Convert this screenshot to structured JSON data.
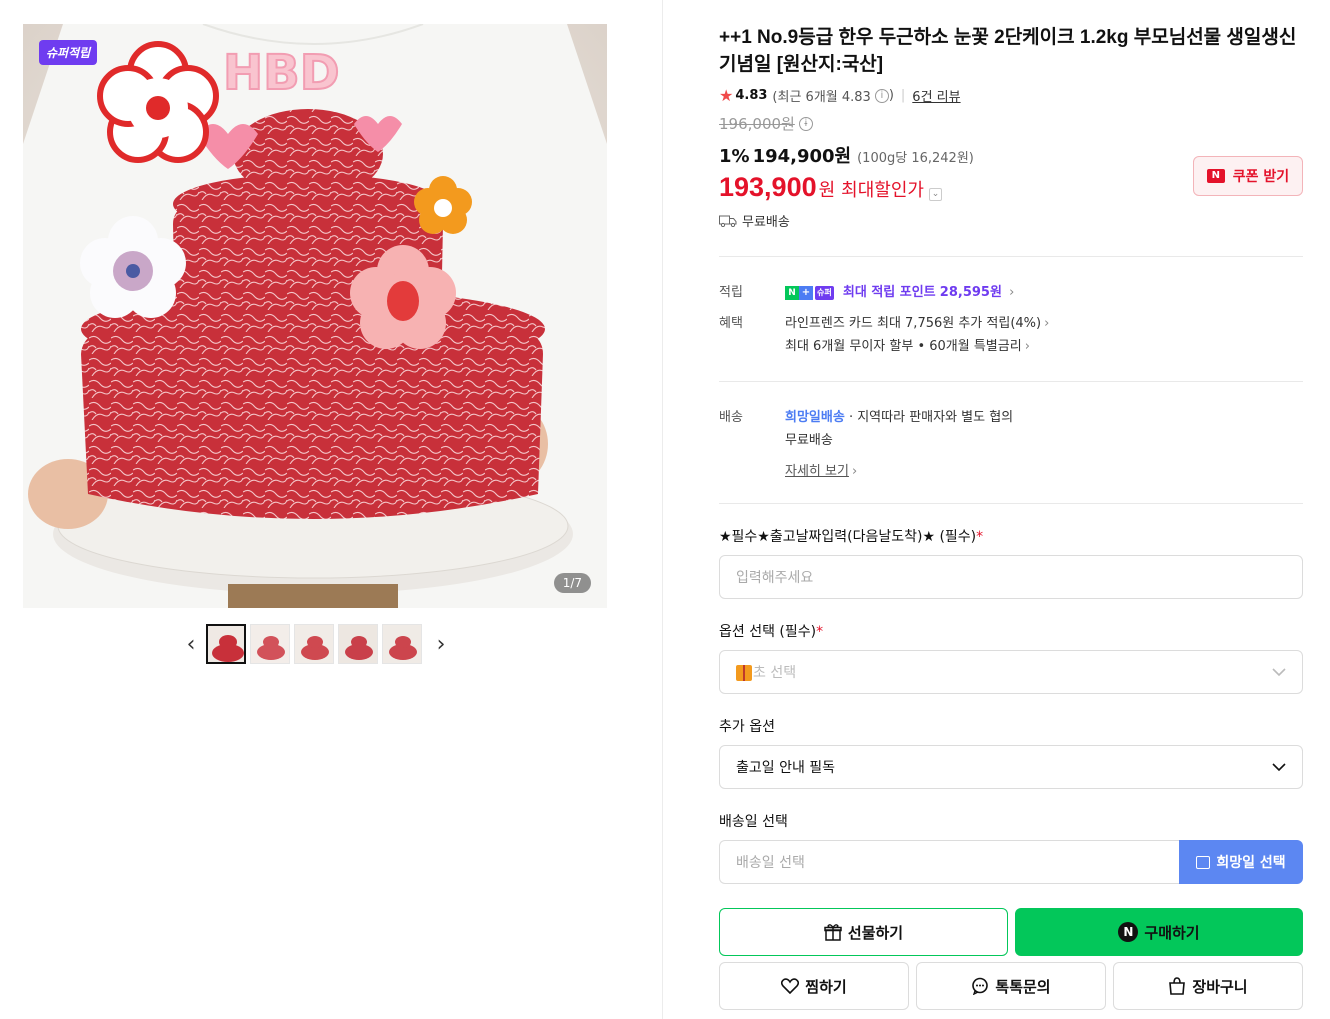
{
  "gallery": {
    "badge": "슈퍼적립",
    "counter": "1/7",
    "thumbnail_count": 5
  },
  "product": {
    "title": "++1 No.9등급 한우 두근하소 눈꽃 2단케이크 1.2kg 부모님선물 생일생신 기념일 [원산지:국산]",
    "rating": "4.83",
    "rating_recent": "(최근 6개월 4.83",
    "rating_close": ")",
    "reviews": "6건 리뷰",
    "original_price": "196,000원",
    "sale_rate": "1%",
    "sale_price": "194,900원",
    "unit_price": "(100g당 16,242원)",
    "max_price": "193,900",
    "max_won": "원",
    "max_label": "최대할인가",
    "coupon_label": "쿠폰 받기",
    "shipping": "무료배송"
  },
  "benefits": {
    "points_label": "적립",
    "points_text": "최대 적립 포인트",
    "points_value": "28,595원",
    "benefit_label": "혜택",
    "benefit_line1": "라인프렌즈 카드 최대 7,756원 추가 적립(4%)",
    "benefit_line2": "최대 6개월 무이자 할부 • 60개월 특별금리",
    "delivery_label": "배송",
    "delivery_type": "희망일배송",
    "delivery_desc": "· 지역따라 판매자와 별도 협의",
    "delivery_fee": "무료배송",
    "details_link": "자세히 보기"
  },
  "form": {
    "field1_label": "★필수★출고날짜입력(다음날도착)★ (필수)",
    "field1_placeholder": "입력해주세요",
    "field2_label": "옵션 선택 (필수)",
    "field2_placeholder": "초 선택",
    "field3_label": "추가 옵션",
    "field3_value": "출고일 안내 필독",
    "field4_label": "배송일 선택",
    "field4_placeholder": "배송일 선택",
    "date_button": "희망일 선택"
  },
  "actions": {
    "gift": "선물하기",
    "buy": "구매하기",
    "wish": "찜하기",
    "talk": "톡톡문의",
    "cart": "장바구니"
  },
  "colors": {
    "accent_red": "#e4122a",
    "naver_green": "#03c75a",
    "super_purple": "#6f3cf0",
    "date_blue": "#5c87f2"
  }
}
